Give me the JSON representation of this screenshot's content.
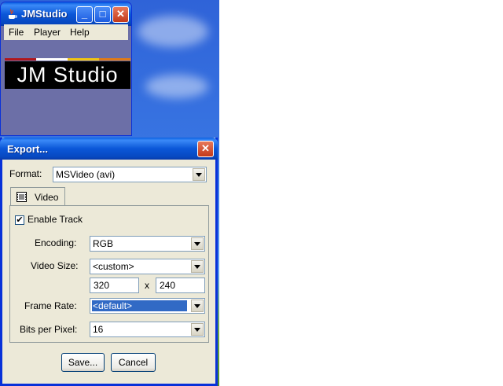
{
  "jmstudio": {
    "title": "JMStudio",
    "window_controls": {
      "minimize": "_",
      "maximize": "□",
      "close": "✕"
    },
    "menu": [
      "File",
      "Player",
      "Help"
    ],
    "banner_text": "JM Studio",
    "stripe_colors": [
      "#b0161c",
      "#ffffff",
      "#f2c511",
      "#e07a16"
    ]
  },
  "export_dialog": {
    "title": "Export...",
    "close": "✕",
    "format_label": "Format:",
    "format_value": "MSVideo (avi)",
    "tab_label": "Video",
    "enable_track_label": "Enable Track",
    "enable_track_checked": "✔",
    "encoding_label": "Encoding:",
    "encoding_value": "RGB",
    "video_size_label": "Video Size:",
    "video_size_value": "<custom>",
    "width_value": "320",
    "x_label": "x",
    "height_value": "240",
    "frame_rate_label": "Frame Rate:",
    "frame_rate_value": "<default>",
    "bits_per_pixel_label": "Bits per Pixel:",
    "bits_per_pixel_value": "16",
    "save_button": "Save...",
    "cancel_button": "Cancel"
  }
}
